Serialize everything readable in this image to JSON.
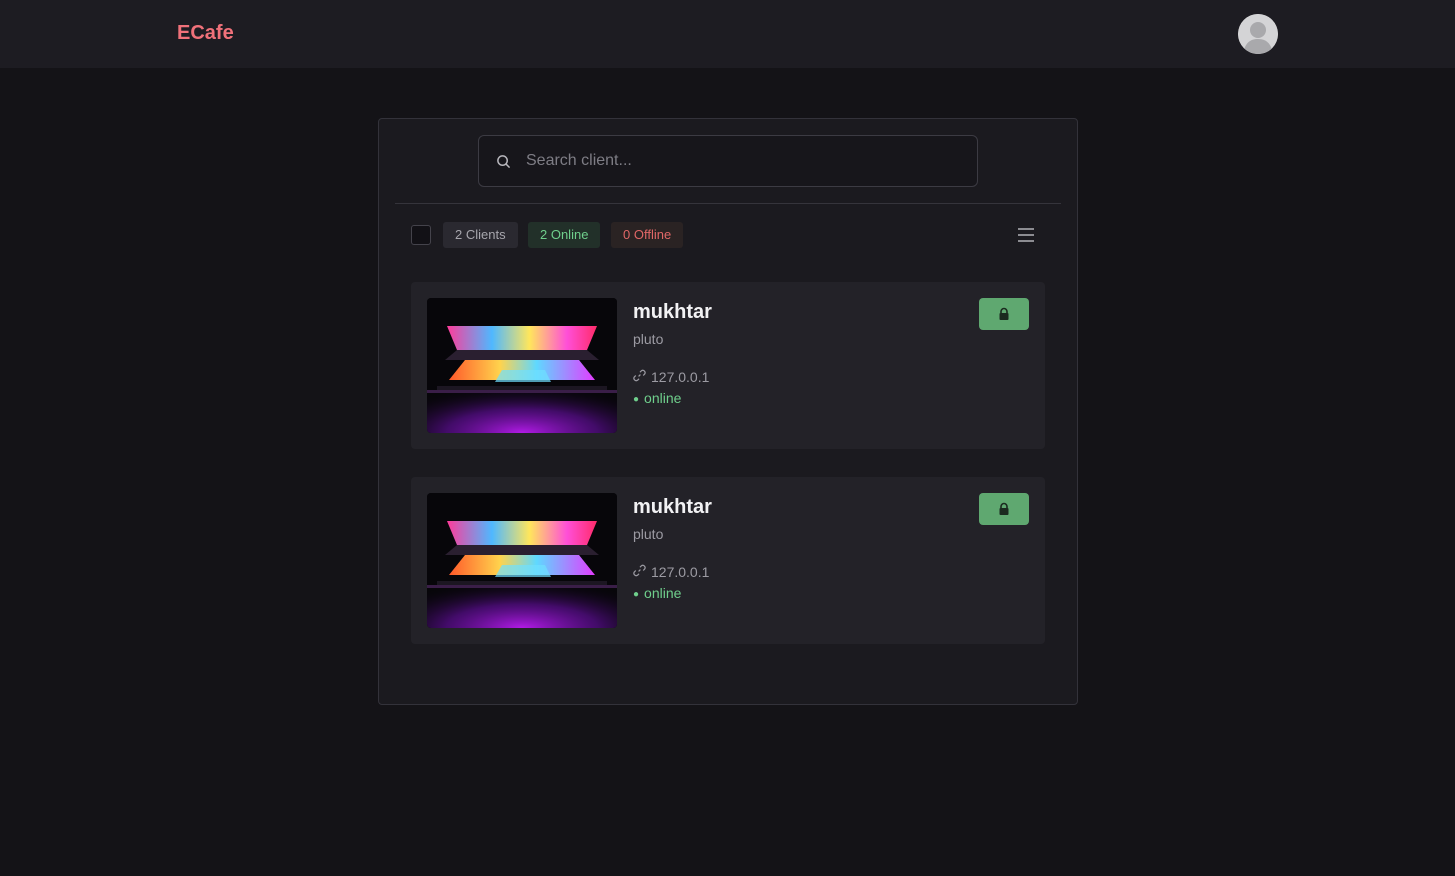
{
  "app": {
    "brand": "ECafe"
  },
  "search": {
    "placeholder": "Search client...",
    "value": ""
  },
  "summary": {
    "clients_label": "2 Clients",
    "online_label": "2 Online",
    "offline_label": "0 Offline"
  },
  "clients": [
    {
      "name": "mukhtar",
      "sub": "pluto",
      "ip": "127.0.0.1",
      "status": "online"
    },
    {
      "name": "mukhtar",
      "sub": "pluto",
      "ip": "127.0.0.1",
      "status": "online"
    }
  ],
  "icons": {
    "search": "search-icon",
    "menu": "hamburger-menu-icon",
    "lock": "lock-icon",
    "link": "link-icon",
    "avatar": "user-avatar"
  },
  "colors": {
    "brand": "#f0717a",
    "online": "#6fcf8c",
    "offline": "#e06767",
    "lock_button": "#5fa870"
  }
}
